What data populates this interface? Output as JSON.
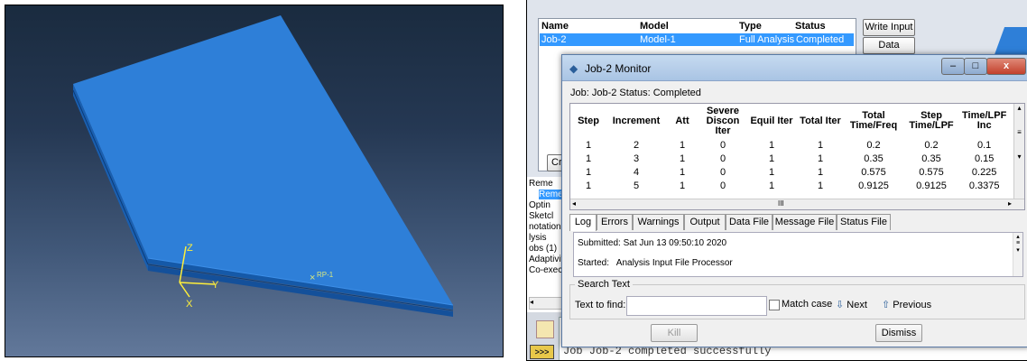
{
  "viewport": {
    "axis_z": "Z",
    "axis_y": "Y",
    "axis_x": "X",
    "ref_point": "RP-1",
    "colors": {
      "plate": "#2e7fd8",
      "plate_edge": "#1a63b8",
      "triad": "#ffef3a",
      "refpoint": "#d8e880"
    }
  },
  "job_manager": {
    "headers": [
      "Name",
      "Model",
      "Type",
      "Status"
    ],
    "rows": [
      {
        "name": "Job-2",
        "model": "Model-1",
        "type": "Full Analysis",
        "status": "Completed"
      }
    ],
    "buttons": {
      "write_input": "Write Input",
      "data_check": "Data Check",
      "create": "Cre"
    }
  },
  "tree": {
    "items": [
      "Reme",
      "Reme",
      "Optin",
      "Sketcl",
      "notations",
      "lysis",
      "obs (1)",
      "Adaptivit",
      "Co-execu"
    ]
  },
  "messages": {
    "text": "Job Job-2 completed successfully"
  },
  "monitor": {
    "title": "Job-2 Monitor",
    "status_line": "Job:  Job-2   Status:  Completed",
    "columns": [
      "Step",
      "Increment",
      "Att",
      "Severe Discon Iter",
      "Equil Iter",
      "Total Iter",
      "Total Time/Freq",
      "Step Time/LPF",
      "Time/LPF Inc"
    ],
    "rows": [
      [
        "1",
        "2",
        "1",
        "0",
        "1",
        "1",
        "0.2",
        "0.2",
        "0.1"
      ],
      [
        "1",
        "3",
        "1",
        "0",
        "1",
        "1",
        "0.35",
        "0.35",
        "0.15"
      ],
      [
        "1",
        "4",
        "1",
        "0",
        "1",
        "1",
        "0.575",
        "0.575",
        "0.225"
      ],
      [
        "1",
        "5",
        "1",
        "0",
        "1",
        "1",
        "0.9125",
        "0.9125",
        "0.3375"
      ]
    ],
    "hscroll_marker": "III",
    "tabs": [
      "Log",
      "Errors",
      "Warnings",
      "Output",
      "Data File",
      "Message File",
      "Status File"
    ],
    "log_lines": [
      "Submitted: Sat Jun 13 09:50:10 2020",
      "Started:   Analysis Input File Processor"
    ],
    "search": {
      "legend": "Search Text",
      "find_label": "Text to find:",
      "find_value": "",
      "match_case": "Match case",
      "next": "Next",
      "previous": "Previous"
    },
    "kill": "Kill",
    "dismiss": "Dismiss"
  }
}
